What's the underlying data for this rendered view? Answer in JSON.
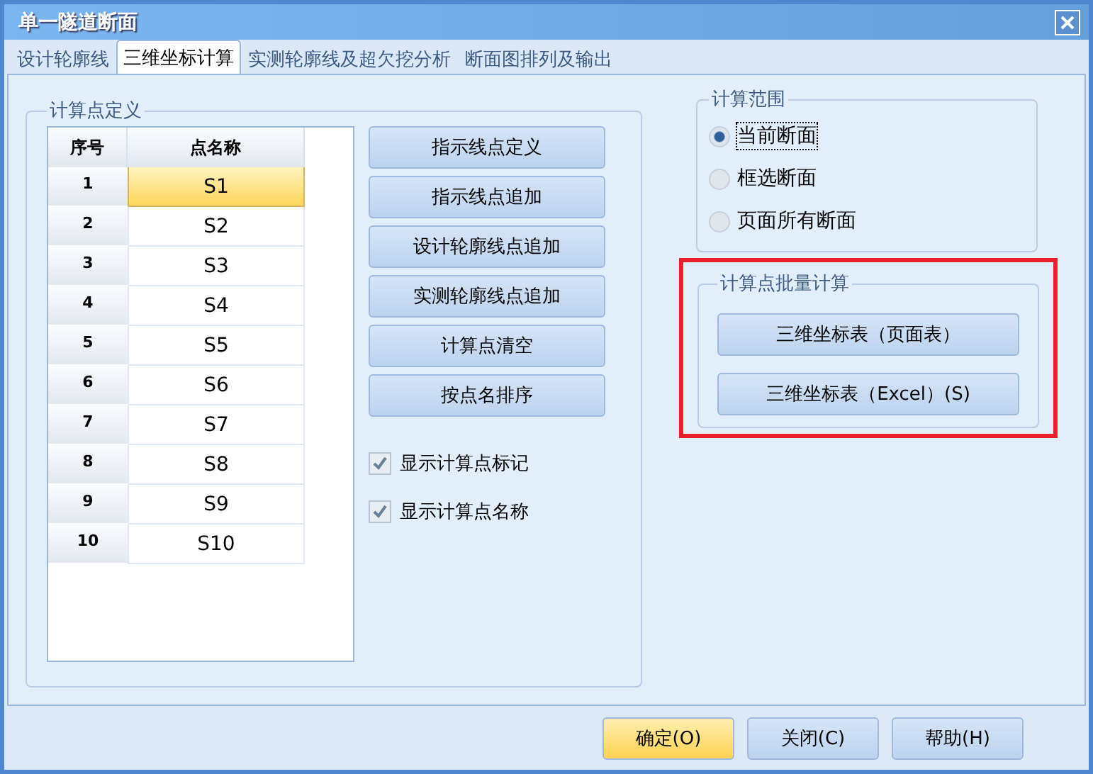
{
  "window": {
    "title": "单一隧道断面"
  },
  "tabs": [
    {
      "label": "设计轮廓线",
      "selected": false
    },
    {
      "label": "三维坐标计算",
      "selected": true
    },
    {
      "label": "实测轮廓线及超欠挖分析",
      "selected": false
    },
    {
      "label": "断面图排列及输出",
      "selected": false
    }
  ],
  "point_definition": {
    "title": "计算点定义",
    "table": {
      "columns": [
        "序号",
        "点名称"
      ],
      "rows": [
        {
          "index": "1",
          "name": "S1",
          "selected": true
        },
        {
          "index": "2",
          "name": "S2",
          "selected": false
        },
        {
          "index": "3",
          "name": "S3",
          "selected": false
        },
        {
          "index": "4",
          "name": "S4",
          "selected": false
        },
        {
          "index": "5",
          "name": "S5",
          "selected": false
        },
        {
          "index": "6",
          "name": "S6",
          "selected": false
        },
        {
          "index": "7",
          "name": "S7",
          "selected": false
        },
        {
          "index": "8",
          "name": "S8",
          "selected": false
        },
        {
          "index": "9",
          "name": "S9",
          "selected": false
        },
        {
          "index": "10",
          "name": "S10",
          "selected": false
        }
      ]
    },
    "buttons": [
      "指示线点定义",
      "指示线点追加",
      "设计轮廓线点追加",
      "实测轮廓线点追加",
      "计算点清空",
      "按点名排序"
    ],
    "checkboxes": [
      {
        "label": "显示计算点标记",
        "checked": true
      },
      {
        "label": "显示计算点名称",
        "checked": true
      }
    ]
  },
  "calc_range": {
    "title": "计算范围",
    "options": [
      {
        "label": "当前断面",
        "selected": true
      },
      {
        "label": "框选断面",
        "selected": false
      },
      {
        "label": "页面所有断面",
        "selected": false
      }
    ]
  },
  "batch_calc": {
    "title": "计算点批量计算",
    "highlighted": true,
    "buttons": [
      "三维坐标表（页面表）",
      "三维坐标表（Excel）(S)"
    ]
  },
  "footer_buttons": [
    {
      "label": "确定(O)",
      "default": true
    },
    {
      "label": "关闭(C)",
      "default": false
    },
    {
      "label": "帮助(H)",
      "default": false
    }
  ]
}
